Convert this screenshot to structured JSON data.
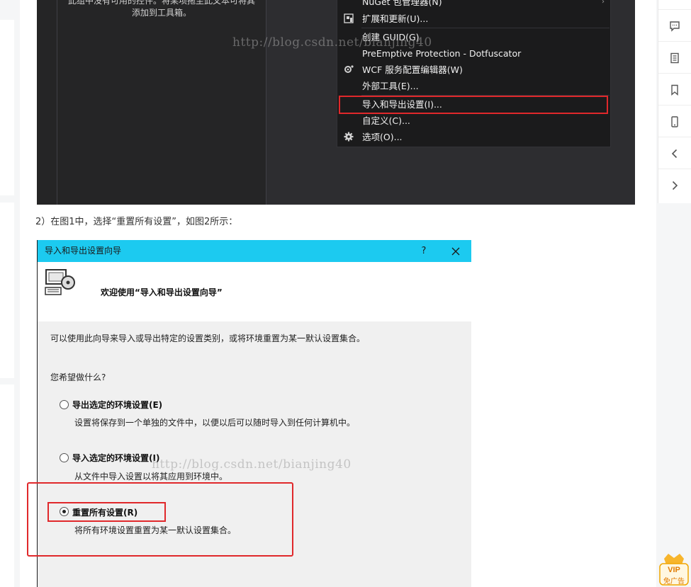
{
  "vs_screenshot": {
    "toolbox_empty_text": [
      "此组中没有可用的控件。将某项拖至此文本可将其",
      "添加到工具箱。"
    ],
    "menu_items": [
      {
        "label": "NuGet 包管理器(N)",
        "icon": "nuget-icon",
        "submenu": true
      },
      {
        "label": "扩展和更新(U)...",
        "icon": "extensions-icon"
      },
      {
        "label": "创建 GUID(G)",
        "icon": ""
      },
      {
        "label": "PreEmptive Protection - Dotfuscator",
        "icon": ""
      },
      {
        "label": "WCF 服务配置编辑器(W)",
        "icon": "wcf-config-icon"
      },
      {
        "label": "外部工具(E)...",
        "icon": ""
      },
      {
        "label": "导入和导出设置(I)...",
        "icon": "",
        "highlighted": true
      },
      {
        "label": "自定义(C)...",
        "icon": ""
      },
      {
        "label": "选项(O)...",
        "icon": "gear-icon"
      }
    ],
    "submenu_arrow": "›"
  },
  "watermark": "http://blog.csdn.net/bianjing40",
  "step_text": "2）在图1中，选择“重置所有设置”，如图2所示：",
  "dialog": {
    "title": "导入和导出设置向导",
    "help_label": "?",
    "welcome": "欢迎使用“导入和导出设置向导”",
    "intro": "可以使用此向导来导入或导出特定的设置类别，或将环境重置为某一默认设置集合。",
    "question": "您希望做什么?",
    "options": [
      {
        "label": "导出选定的环境设置(E)",
        "description": "设置将保存到一个单独的文件中，以便以后可以随时导入到任何计算机中。",
        "checked": false
      },
      {
        "label": "导入选定的环境设置(I)",
        "description": "从文件中导入设置以将其应用到环境中。",
        "checked": false
      },
      {
        "label": "重置所有设置(R)",
        "description": "将所有环境设置重置为某一默认设置集合。",
        "checked": true
      }
    ],
    "accent_color": "#1ccaf0"
  },
  "vip_badge": {
    "top": "VIP",
    "bottom": "免广告"
  },
  "right_toolbar": [
    "arrow-up-icon",
    "comment-icon",
    "document-icon",
    "bookmark-icon",
    "mobile-icon",
    "chevron-left-icon",
    "chevron-right-icon"
  ]
}
